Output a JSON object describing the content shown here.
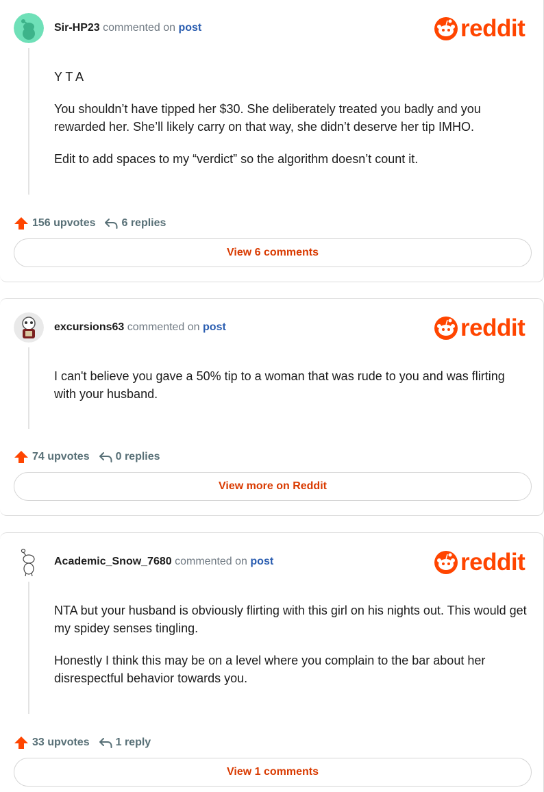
{
  "brand": {
    "wordmark": "reddit",
    "accent": "#ff4500",
    "link_color": "#2a5db0",
    "button_text_color": "#d93a00"
  },
  "comments": [
    {
      "username": "Sir-HP23",
      "commented_on": "commented on",
      "post_link": "post",
      "paragraphs": [
        "Y T A",
        "You shouldn’t have tipped her $30. She deliberately treated you badly and you rewarded her. She’ll likely carry on that way, she didn’t deserve her tip IMHO.",
        "Edit to add spaces to my “verdict” so the algorithm doesn’t count it."
      ],
      "upvotes": "156 upvotes",
      "replies": "6 replies",
      "button": "View 6 comments"
    },
    {
      "username": "excursions63",
      "commented_on": "commented on",
      "post_link": "post",
      "paragraphs": [
        "I can't believe you gave a 50% tip to a woman that was rude to you and was flirting with your husband."
      ],
      "upvotes": "74 upvotes",
      "replies": "0 replies",
      "button": "View more on Reddit"
    },
    {
      "username": "Academic_Snow_7680",
      "commented_on": "commented on",
      "post_link": "post",
      "paragraphs": [
        "NTA but your husband is obviously flirting with this girl on his nights out. This would get my spidey senses tingling.",
        "Honestly I think this may be on a level where you complain to the bar about her disrespectful behavior towards you."
      ],
      "upvotes": "33 upvotes",
      "replies": "1 reply",
      "button": "View 1 comments"
    }
  ]
}
